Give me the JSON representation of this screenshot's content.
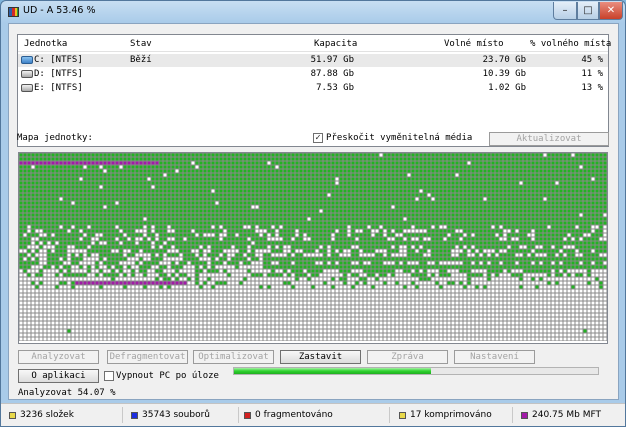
{
  "window": {
    "title": "UD - A  53.46 %"
  },
  "titlebar": {
    "min": "–",
    "max": "□",
    "close": "✕"
  },
  "drives": {
    "headers": [
      "Jednotka",
      "Stav",
      "Kapacita",
      "Volné místo",
      "% volného místa"
    ],
    "rows": [
      {
        "drive": "C: [NTFS]",
        "status": "Běží",
        "capacity": "51.97 Gb",
        "free": "23.70 Gb",
        "percent": "45 %",
        "icon": "system-drive-icon"
      },
      {
        "drive": "D: [NTFS]",
        "status": "",
        "capacity": "87.88 Gb",
        "free": "10.39 Gb",
        "percent": "11 %",
        "icon": "hard-drive-icon"
      },
      {
        "drive": "E: [NTFS]",
        "status": "",
        "capacity": "7.53 Gb",
        "free": "1.02 Gb",
        "percent": "13 %",
        "icon": "hard-drive-icon"
      }
    ]
  },
  "map": {
    "label": "Mapa jednotky:",
    "skip_removable": {
      "label": "Přeskočit vyměnitelná média",
      "checked": true,
      "mark": "✓"
    },
    "refresh": "Aktualizovat",
    "colors": {
      "used": "#22b322",
      "free": "#ffffff",
      "mft": "#a21aa8",
      "grid": "#8a8a8a"
    }
  },
  "actions": {
    "analyze": "Analyzovat",
    "defragment": "Defragmentovat",
    "optimize": "Optimalizovat",
    "stop": "Zastavit",
    "report": "Zpráva",
    "settings": "Nastavení",
    "about": "O aplikaci",
    "shutdown": "Vypnout PC po úloze"
  },
  "progress": {
    "text": "Analyzovat  54.07 %",
    "value": 0.5407
  },
  "status": [
    {
      "text": "3236 složek",
      "color": "#e8d84a",
      "icon": "folders-icon"
    },
    {
      "text": "35743 souborů",
      "color": "#1c2ee0",
      "icon": "files-icon"
    },
    {
      "text": "0 fragmentováno",
      "color": "#d32020",
      "icon": "fragmented-icon"
    },
    {
      "text": "17 komprimováno",
      "color": "#e8d84a",
      "icon": "compressed-icon"
    },
    {
      "text": "240.75 Mb MFT",
      "color": "#a21aa8",
      "icon": "mft-icon"
    }
  ]
}
